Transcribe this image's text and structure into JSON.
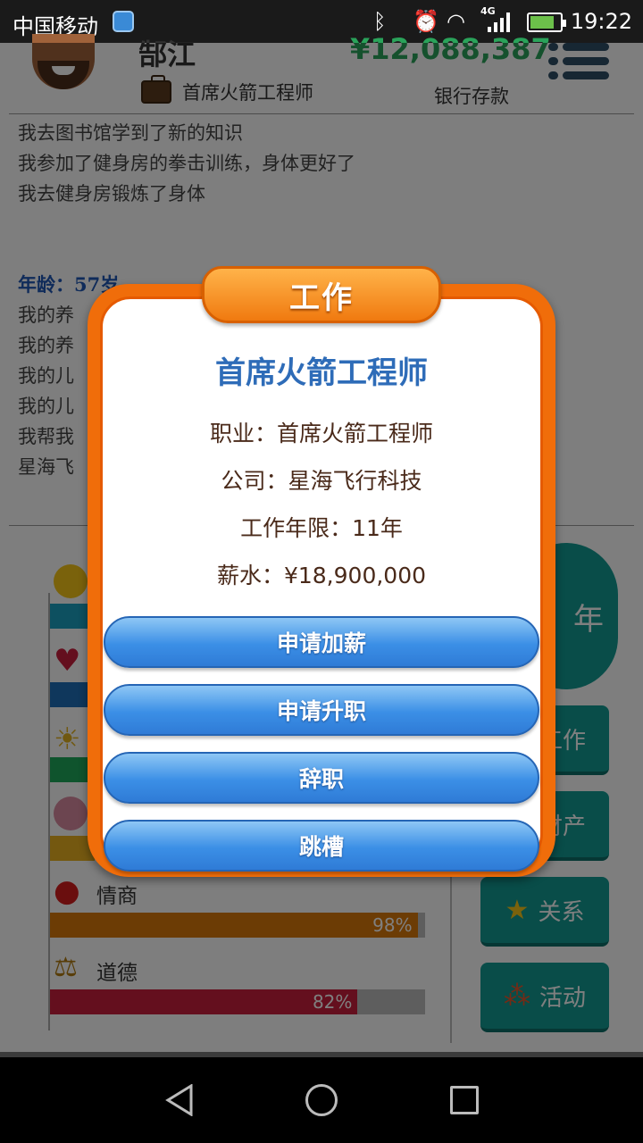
{
  "status_bar": {
    "carrier": "中国移动",
    "network": "4G",
    "time": "19:22"
  },
  "header": {
    "name": "郜江",
    "money": "¥12,088,387",
    "job": "首席火箭工程师",
    "bank_label": "银行存款"
  },
  "log": {
    "lines_top": [
      "我去图书馆学到了新的知识",
      "我参加了健身房的拳击训练，身体更好了",
      "我去健身房锻炼了身体"
    ],
    "age_label": "年龄：57岁",
    "lines_bottom": [
      "我的养",
      "我的养",
      "我的儿",
      "我的儿",
      "我帮我",
      "星海飞"
    ]
  },
  "stats": [
    {
      "label": "情商",
      "percent": 98,
      "pct_text": "98%",
      "color": "#d9780a"
    },
    {
      "label": "道德",
      "percent": 82,
      "pct_text": "82%",
      "color": "#c81e3c"
    }
  ],
  "side_buttons": {
    "year": "年",
    "work": "工作",
    "assets": "财产",
    "relations": "关系",
    "activities": "活动"
  },
  "dialog": {
    "tab_title": "工作",
    "title": "首席火箭工程师",
    "occupation": "职业：首席火箭工程师",
    "company": "公司：星海飞行科技",
    "years": "工作年限：11年",
    "salary": "薪水：¥18,900,000",
    "buttons": [
      "申请加薪",
      "申请升职",
      "辞职",
      "跳槽"
    ]
  },
  "colors": {
    "dialog_orange": "#f06d0a",
    "button_blue": "#3b8fe6",
    "teal": "#139b93"
  }
}
